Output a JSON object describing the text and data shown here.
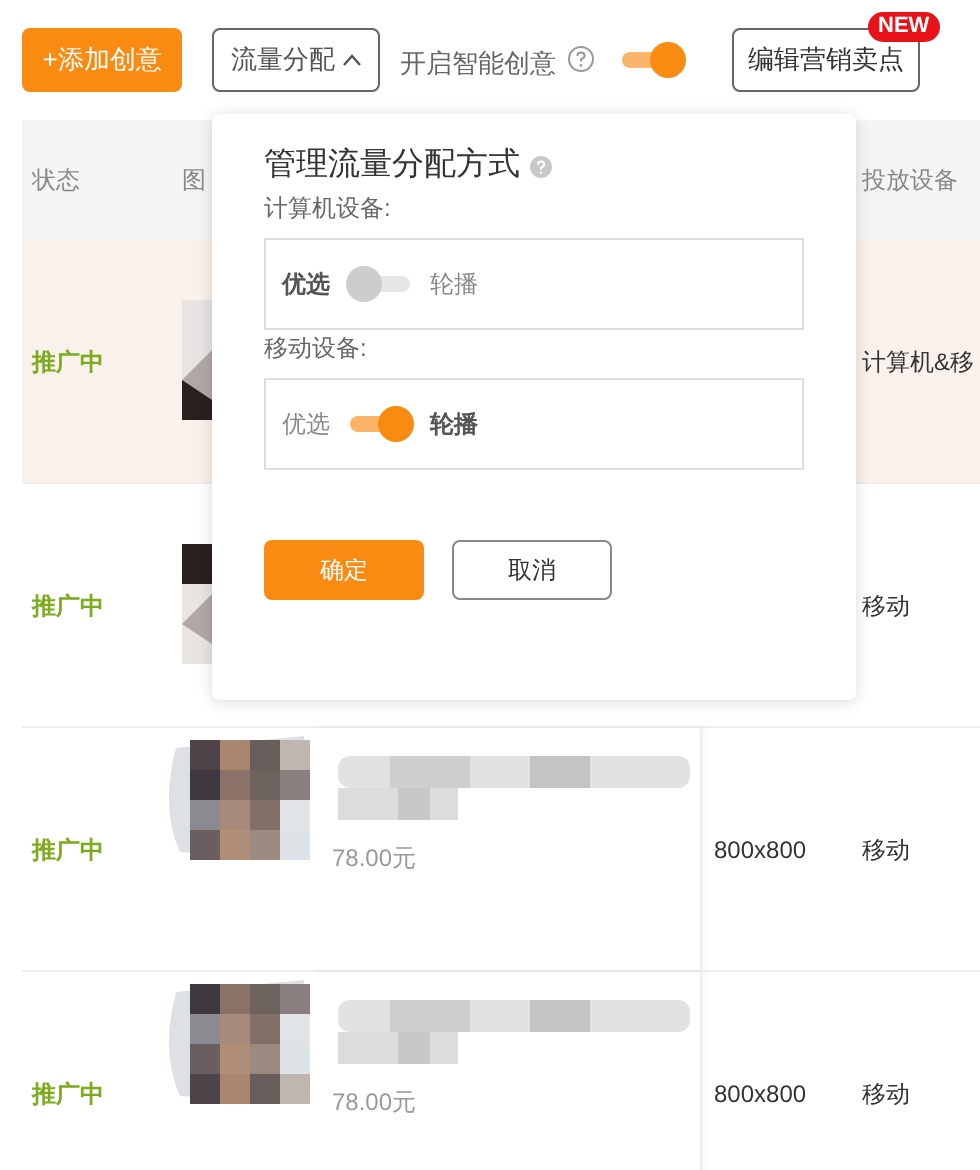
{
  "toolbar": {
    "add_button": "+添加创意",
    "traffic_button": {
      "label": "流量分配",
      "expanded": true
    },
    "smart_creative": {
      "label": "开启智能创意",
      "on": true
    },
    "selling_points_button": {
      "label": "编辑营销卖点",
      "badge": "NEW"
    }
  },
  "table": {
    "columns": [
      "状态",
      "图",
      "投放设备"
    ],
    "rows": [
      {
        "kind": "covered",
        "selected": true,
        "status": "推广中",
        "device": "计算机&移"
      },
      {
        "kind": "covered",
        "selected": false,
        "status": "推广中",
        "device": "移动"
      },
      {
        "kind": "full",
        "selected": false,
        "status": "推广中",
        "price": "78.00元",
        "size": "800x800",
        "device": "移动"
      },
      {
        "kind": "full",
        "selected": false,
        "status": "推广中",
        "price": "78.00元",
        "size": "800x800",
        "device": "移动"
      }
    ]
  },
  "popup": {
    "title": "管理流量分配方式",
    "groups": [
      {
        "label": "计算机设备:",
        "left": "优选",
        "right": "轮播",
        "on": false
      },
      {
        "label": "移动设备:",
        "left": "优选",
        "right": "轮播",
        "on": true
      }
    ],
    "confirm": "确定",
    "cancel": "取消"
  }
}
